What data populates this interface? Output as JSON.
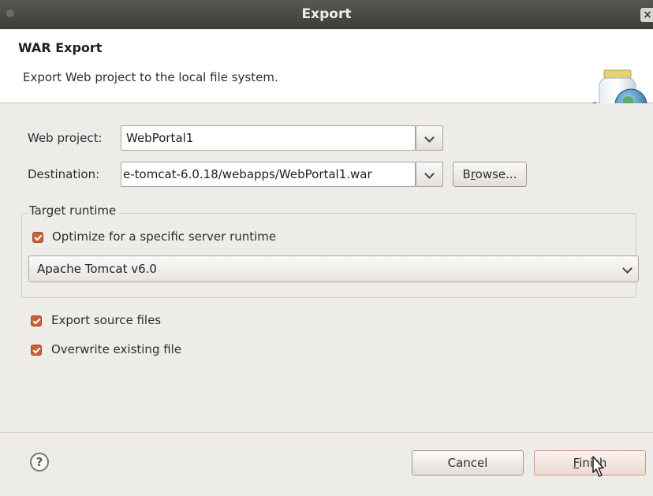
{
  "window": {
    "title": "Export",
    "close_icon": "×"
  },
  "banner": {
    "title": "WAR Export",
    "description": "Export Web project to the local file system.",
    "icon": "web-archive-globe-icon"
  },
  "form": {
    "web_project_label": "Web project:",
    "web_project_value": "WebPortal1",
    "destination_label": "Destination:",
    "destination_value": "e-tomcat-6.0.18/webapps/WebPortal1.war",
    "browse_label_pre": "B",
    "browse_label_mnemonic": "r",
    "browse_label_post": "owse..."
  },
  "target_runtime": {
    "legend": "Target runtime",
    "optimize_label": "Optimize for a specific server runtime",
    "optimize_checked": true,
    "runtime_value": "Apache Tomcat v6.0"
  },
  "options": {
    "export_source_label": "Export source files",
    "export_source_checked": true,
    "overwrite_label": "Overwrite existing file",
    "overwrite_checked": true
  },
  "footer": {
    "help_icon": "?",
    "cancel_label": "Cancel",
    "finish_mnemonic": "F",
    "finish_label_rest": "inish"
  },
  "colors": {
    "checkbox": "#c5623a",
    "titlebar": "#3d3c38",
    "content_bg": "#edece9"
  }
}
